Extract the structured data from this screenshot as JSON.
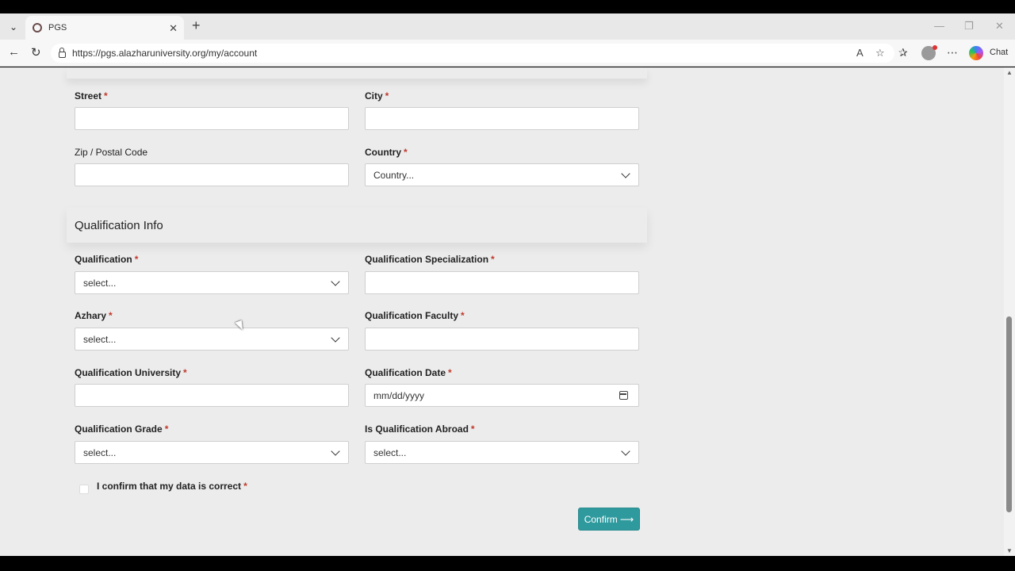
{
  "browser": {
    "tab_title": "PGS",
    "url": "https://pgs.alazharuniversity.org/my/account",
    "chat_label": "Chat"
  },
  "address": {
    "street_label": "Street",
    "city_label": "City",
    "zip_label": "Zip / Postal Code",
    "country_label": "Country",
    "country_value": "Country..."
  },
  "qualification": {
    "section_title": "Qualification Info",
    "qualification_label": "Qualification",
    "qualification_value": "select...",
    "specialization_label": "Qualification Specialization",
    "azhary_label": "Azhary",
    "azhary_value": "select...",
    "faculty_label": "Qualification Faculty",
    "university_label": "Qualification University",
    "date_label": "Qualification Date",
    "date_value": "mm/dd/yyyy",
    "grade_label": "Qualification Grade",
    "grade_value": "select...",
    "abroad_label": "Is Qualification Abroad",
    "abroad_value": "select..."
  },
  "form": {
    "confirm_check_label": "I confirm that my data is correct",
    "confirm_button": "Confirm ⟶",
    "required_mark": "*"
  }
}
